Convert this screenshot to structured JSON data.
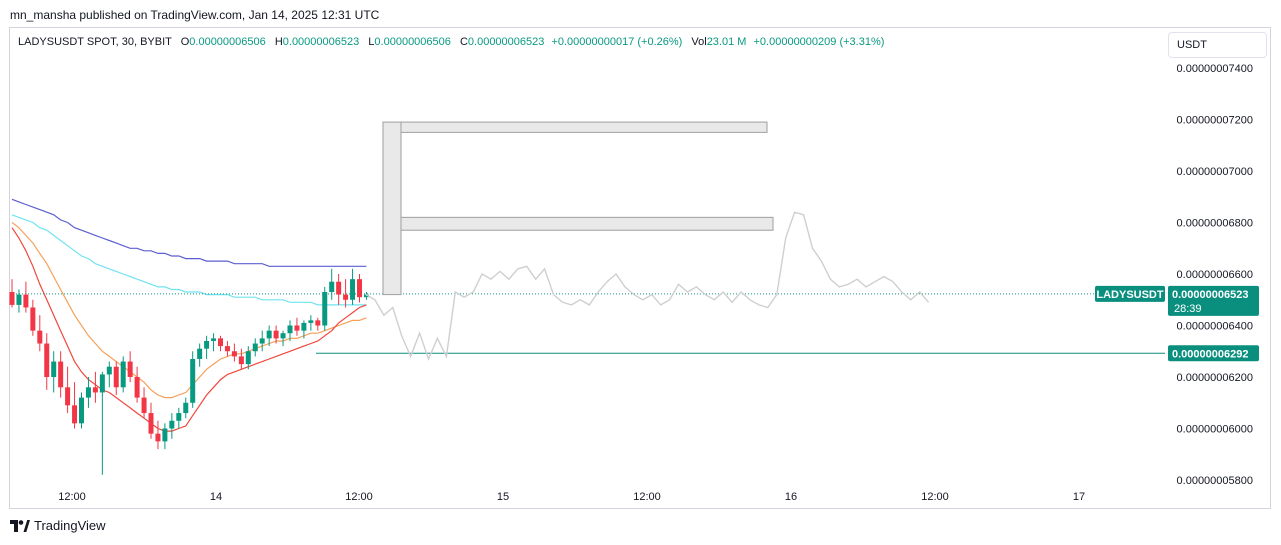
{
  "header": {
    "text": "mn_mansha published on TradingView.com, Jan 14, 2025 12:31 UTC"
  },
  "legend": {
    "symbol": "LADYSUSDT SPOT, 30, BYBIT",
    "o_label": "O",
    "o_value": "0.00000006506",
    "h_label": "H",
    "h_value": "0.00000006523",
    "l_label": "L",
    "l_value": "0.00000006506",
    "c_label": "C",
    "c_value": "0.00000006523",
    "change": "+0.00000000017 (+0.26%)",
    "vol_label": "Vol",
    "vol_value": "23.01 M",
    "vol_change": "+0.00000000209 (+3.31%)"
  },
  "currency_button": "USDT",
  "footer": {
    "brand": "TradingView"
  },
  "colors": {
    "up": "#089981",
    "down": "#f23645",
    "accent": "#0a8f7f",
    "ema_blue": "#5b5fd1",
    "ema_cyan": "#6fe3ef",
    "ema_orange": "#f5a15a",
    "ema_red": "#f0463c",
    "projection": "#cfcfcf"
  },
  "chart_data": {
    "type": "candlestick",
    "symbol": "LADYSUSDT",
    "timeframe": "30",
    "y_ticks": [
      "0.00000007400",
      "0.00000007200",
      "0.00000007000",
      "0.00000006800",
      "0.00000006600",
      "0.00000006400",
      "0.00000006200",
      "0.00000006000",
      "0.00000005800"
    ],
    "y_tick_values": [
      7.4,
      7.2,
      7.0,
      6.8,
      6.6,
      6.4,
      6.2,
      6.0,
      5.8
    ],
    "x_ticks": [
      "12:00",
      "14",
      "12:00",
      "15",
      "12:00",
      "16",
      "12:00",
      "17"
    ],
    "x_tick_index": [
      0,
      5,
      10,
      15,
      20,
      25,
      30,
      35
    ],
    "ylim": [
      5.8,
      7.4
    ],
    "y_unit_note_value_scale": "1e-8",
    "price_label": {
      "symbol": "LADYSUSDT",
      "price": "0.00000006523",
      "countdown": "28:39",
      "value": 6.523
    },
    "level_label": {
      "price": "0.00000006292",
      "value": 6.292
    },
    "candles": [
      {
        "o": 6.53,
        "h": 6.58,
        "l": 6.47,
        "c": 6.48
      },
      {
        "o": 6.48,
        "h": 6.54,
        "l": 6.45,
        "c": 6.52
      },
      {
        "o": 6.52,
        "h": 6.57,
        "l": 6.45,
        "c": 6.47
      },
      {
        "o": 6.47,
        "h": 6.5,
        "l": 6.36,
        "c": 6.38
      },
      {
        "o": 6.38,
        "h": 6.44,
        "l": 6.3,
        "c": 6.33
      },
      {
        "o": 6.33,
        "h": 6.37,
        "l": 6.15,
        "c": 6.2
      },
      {
        "o": 6.2,
        "h": 6.3,
        "l": 6.14,
        "c": 6.26
      },
      {
        "o": 6.26,
        "h": 6.3,
        "l": 6.12,
        "c": 6.16
      },
      {
        "o": 6.16,
        "h": 6.24,
        "l": 6.06,
        "c": 6.09
      },
      {
        "o": 6.09,
        "h": 6.18,
        "l": 6.0,
        "c": 6.02
      },
      {
        "o": 6.02,
        "h": 6.14,
        "l": 6.0,
        "c": 6.12
      },
      {
        "o": 6.12,
        "h": 6.2,
        "l": 6.08,
        "c": 6.16
      },
      {
        "o": 6.16,
        "h": 6.22,
        "l": 6.1,
        "c": 6.14
      },
      {
        "o": 6.14,
        "h": 6.22,
        "l": 5.82,
        "c": 6.21
      },
      {
        "o": 6.21,
        "h": 6.26,
        "l": 6.16,
        "c": 6.24
      },
      {
        "o": 6.24,
        "h": 6.26,
        "l": 6.13,
        "c": 6.16
      },
      {
        "o": 6.16,
        "h": 6.28,
        "l": 6.14,
        "c": 6.26
      },
      {
        "o": 6.26,
        "h": 6.3,
        "l": 6.18,
        "c": 6.2
      },
      {
        "o": 6.2,
        "h": 6.24,
        "l": 6.1,
        "c": 6.12
      },
      {
        "o": 6.12,
        "h": 6.16,
        "l": 6.04,
        "c": 6.06
      },
      {
        "o": 6.06,
        "h": 6.1,
        "l": 5.96,
        "c": 5.98
      },
      {
        "o": 5.98,
        "h": 6.03,
        "l": 5.92,
        "c": 5.95
      },
      {
        "o": 5.95,
        "h": 6.02,
        "l": 5.92,
        "c": 6.0
      },
      {
        "o": 6.0,
        "h": 6.06,
        "l": 5.96,
        "c": 6.03
      },
      {
        "o": 6.03,
        "h": 6.08,
        "l": 6.0,
        "c": 6.06
      },
      {
        "o": 6.06,
        "h": 6.12,
        "l": 6.04,
        "c": 6.1
      },
      {
        "o": 6.1,
        "h": 6.3,
        "l": 6.08,
        "c": 6.27
      },
      {
        "o": 6.27,
        "h": 6.33,
        "l": 6.24,
        "c": 6.31
      },
      {
        "o": 6.31,
        "h": 6.36,
        "l": 6.27,
        "c": 6.34
      },
      {
        "o": 6.34,
        "h": 6.37,
        "l": 6.3,
        "c": 6.35
      },
      {
        "o": 6.35,
        "h": 6.36,
        "l": 6.3,
        "c": 6.32
      },
      {
        "o": 6.32,
        "h": 6.34,
        "l": 6.28,
        "c": 6.3
      },
      {
        "o": 6.3,
        "h": 6.33,
        "l": 6.26,
        "c": 6.28
      },
      {
        "o": 6.28,
        "h": 6.31,
        "l": 6.23,
        "c": 6.25
      },
      {
        "o": 6.25,
        "h": 6.32,
        "l": 6.23,
        "c": 6.3
      },
      {
        "o": 6.3,
        "h": 6.35,
        "l": 6.28,
        "c": 6.33
      },
      {
        "o": 6.33,
        "h": 6.38,
        "l": 6.3,
        "c": 6.35
      },
      {
        "o": 6.35,
        "h": 6.4,
        "l": 6.32,
        "c": 6.38
      },
      {
        "o": 6.38,
        "h": 6.4,
        "l": 6.33,
        "c": 6.35
      },
      {
        "o": 6.35,
        "h": 6.38,
        "l": 6.32,
        "c": 6.37
      },
      {
        "o": 6.37,
        "h": 6.42,
        "l": 6.34,
        "c": 6.4
      },
      {
        "o": 6.4,
        "h": 6.43,
        "l": 6.36,
        "c": 6.38
      },
      {
        "o": 6.38,
        "h": 6.42,
        "l": 6.35,
        "c": 6.41
      },
      {
        "o": 6.41,
        "h": 6.44,
        "l": 6.38,
        "c": 6.42
      },
      {
        "o": 6.42,
        "h": 6.43,
        "l": 6.38,
        "c": 6.4
      },
      {
        "o": 6.4,
        "h": 6.55,
        "l": 6.38,
        "c": 6.53
      },
      {
        "o": 6.53,
        "h": 6.62,
        "l": 6.5,
        "c": 6.57
      },
      {
        "o": 6.57,
        "h": 6.6,
        "l": 6.48,
        "c": 6.52
      },
      {
        "o": 6.52,
        "h": 6.58,
        "l": 6.47,
        "c": 6.5
      },
      {
        "o": 6.5,
        "h": 6.62,
        "l": 6.48,
        "c": 6.58
      },
      {
        "o": 6.58,
        "h": 6.6,
        "l": 6.49,
        "c": 6.51
      },
      {
        "o": 6.51,
        "h": 6.53,
        "l": 6.5,
        "c": 6.52
      }
    ],
    "emas": [
      {
        "name": "EMA 200",
        "color": "#5b5fd1",
        "values": [
          6.89,
          6.88,
          6.87,
          6.86,
          6.85,
          6.84,
          6.83,
          6.81,
          6.8,
          6.78,
          6.77,
          6.76,
          6.75,
          6.74,
          6.73,
          6.72,
          6.71,
          6.7,
          6.7,
          6.69,
          6.69,
          6.68,
          6.68,
          6.67,
          6.67,
          6.66,
          6.66,
          6.66,
          6.65,
          6.65,
          6.65,
          6.65,
          6.64,
          6.64,
          6.64,
          6.64,
          6.64,
          6.63,
          6.63,
          6.63,
          6.63,
          6.63,
          6.63,
          6.63,
          6.63,
          6.63,
          6.63,
          6.63,
          6.63,
          6.63,
          6.63,
          6.63
        ]
      },
      {
        "name": "EMA 100",
        "color": "#6fe3ef",
        "values": [
          6.83,
          6.82,
          6.81,
          6.8,
          6.78,
          6.77,
          6.75,
          6.73,
          6.71,
          6.69,
          6.67,
          6.66,
          6.64,
          6.63,
          6.62,
          6.61,
          6.6,
          6.59,
          6.58,
          6.57,
          6.56,
          6.55,
          6.55,
          6.54,
          6.54,
          6.53,
          6.53,
          6.53,
          6.52,
          6.52,
          6.52,
          6.52,
          6.51,
          6.51,
          6.51,
          6.51,
          6.5,
          6.5,
          6.5,
          6.5,
          6.49,
          6.49,
          6.49,
          6.49,
          6.48,
          6.48,
          6.48,
          6.48,
          6.48,
          6.48,
          6.48,
          6.48
        ]
      },
      {
        "name": "EMA 50",
        "color": "#f5a15a",
        "values": [
          6.8,
          6.78,
          6.75,
          6.72,
          6.68,
          6.64,
          6.59,
          6.54,
          6.49,
          6.44,
          6.4,
          6.36,
          6.33,
          6.3,
          6.28,
          6.26,
          6.24,
          6.22,
          6.2,
          6.18,
          6.15,
          6.13,
          6.12,
          6.12,
          6.13,
          6.14,
          6.17,
          6.2,
          6.23,
          6.25,
          6.27,
          6.28,
          6.29,
          6.29,
          6.3,
          6.31,
          6.32,
          6.33,
          6.34,
          6.34,
          6.35,
          6.35,
          6.36,
          6.37,
          6.37,
          6.38,
          6.39,
          6.4,
          6.41,
          6.42,
          6.42,
          6.43
        ]
      },
      {
        "name": "EMA 20",
        "color": "#f0463c",
        "values": [
          6.78,
          6.74,
          6.69,
          6.63,
          6.56,
          6.5,
          6.44,
          6.38,
          6.32,
          6.26,
          6.22,
          6.19,
          6.17,
          6.15,
          6.14,
          6.12,
          6.1,
          6.08,
          6.06,
          6.04,
          6.02,
          6.0,
          5.99,
          5.99,
          6.0,
          6.01,
          6.05,
          6.09,
          6.13,
          6.16,
          6.19,
          6.21,
          6.22,
          6.23,
          6.24,
          6.25,
          6.26,
          6.27,
          6.28,
          6.29,
          6.3,
          6.31,
          6.32,
          6.33,
          6.34,
          6.36,
          6.38,
          6.41,
          6.43,
          6.45,
          6.47,
          6.48
        ]
      }
    ],
    "projection": [
      6.52,
      6.5,
      6.44,
      6.47,
      6.36,
      6.28,
      6.37,
      6.27,
      6.35,
      6.28,
      6.53,
      6.51,
      6.53,
      6.6,
      6.58,
      6.61,
      6.58,
      6.62,
      6.63,
      6.58,
      6.62,
      6.52,
      6.49,
      6.48,
      6.5,
      6.48,
      6.53,
      6.57,
      6.6,
      6.55,
      6.52,
      6.5,
      6.52,
      6.48,
      6.5,
      6.56,
      6.53,
      6.55,
      6.52,
      6.5,
      6.53,
      6.49,
      6.53,
      6.5,
      6.48,
      6.47,
      6.52,
      6.74,
      6.84,
      6.83,
      6.7,
      6.65,
      6.58,
      6.55,
      6.56,
      6.58,
      6.55,
      6.57,
      6.59,
      6.57,
      6.53,
      6.5,
      6.53,
      6.49
    ]
  }
}
